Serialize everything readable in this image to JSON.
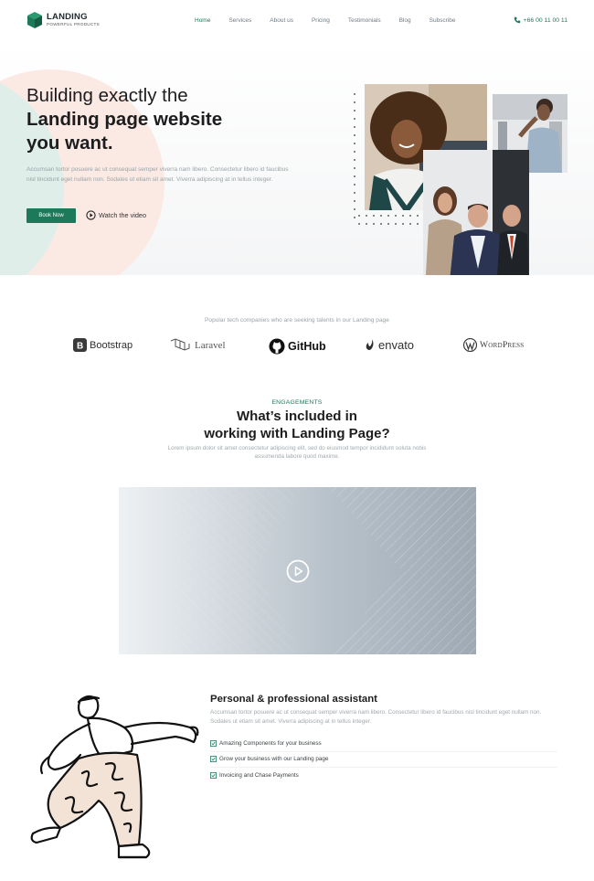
{
  "header": {
    "logo_title": "LANDING",
    "logo_subtitle": "POWERFUL PRODUCTS",
    "nav": [
      {
        "label": "Home",
        "active": true
      },
      {
        "label": "Services",
        "active": false
      },
      {
        "label": "About us",
        "active": false
      },
      {
        "label": "Pricing",
        "active": false
      },
      {
        "label": "Testimonials",
        "active": false
      },
      {
        "label": "Blog",
        "active": false
      },
      {
        "label": "Subscribe",
        "active": false
      }
    ],
    "phone": "+66 00 11 00 11",
    "phone_icon": "phone-icon"
  },
  "hero": {
    "title_line1": "Building exactly the",
    "title_line2": "Landing page website",
    "title_line3": "you want.",
    "description": "Accumsan tortor posuere ac ut consequat semper viverra nam libero. Consectetur libero id faucibus nisl tincidunt eget nullam non. Sodales ut etiam sit amet. Viverra adipiscing at in tellus integer.",
    "book_button": "Book Now",
    "watch_label": "Watch the video",
    "watch_icon": "play-circle-icon"
  },
  "companies": {
    "caption": "Popular tech companies who are seeking talents in our Landing page",
    "brands": [
      {
        "name": "Bootstrap",
        "icon": "bootstrap-logo"
      },
      {
        "name": "Laravel",
        "icon": "laravel-logo"
      },
      {
        "name": "GitHub",
        "icon": "github-logo"
      },
      {
        "name": "envato",
        "icon": "envato-logo"
      },
      {
        "name": "WordPress",
        "icon": "wordpress-logo"
      }
    ]
  },
  "engagements": {
    "label": "ENGAGEMENTS",
    "title_line1": "What’s included in",
    "title_line2": "working with Landing Page?",
    "description": "Lorem ipsum dolor sit amet consectetur adipiscing elit, sed do eiusmod tempor incididunt soluta nobis assumenda labore quod maxime."
  },
  "video": {
    "play_icon": "play-circle-icon"
  },
  "assistant": {
    "title": "Personal & professional assistant",
    "description": "Accumsan tortor posuere ac ut consequat semper viverra nam libero. Consectetur libero id faucibus nisl tincidunt eget nullam non. Sodales ut etiam sit amet. Viverra adipiscing at in tellus integer.",
    "features": [
      "Amazing Components for your business",
      "Grow your business with our Landing page",
      "Invoicing and Chase Payments"
    ],
    "feature_icon": "checkbox-icon"
  },
  "colors": {
    "accent": "#1c7a5a",
    "text_dark": "#1d1d1f",
    "text_muted": "#9aa3a7",
    "blob_green": "#dfeee8",
    "blob_pink": "#fbeae4"
  }
}
